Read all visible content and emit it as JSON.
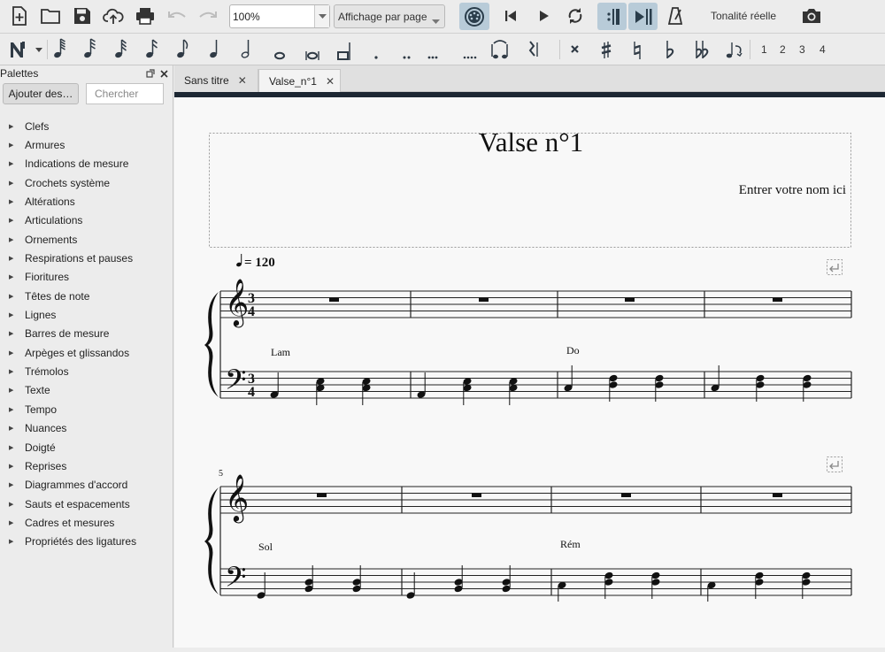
{
  "toolbar": {
    "zoom_value": "100%",
    "view_mode": "Affichage par page",
    "concert_pitch_label": "Tonalité réelle"
  },
  "note_input": {
    "voices": [
      "1",
      "2",
      "3",
      "4"
    ]
  },
  "palettes": {
    "title": "Palettes",
    "add_button": "Ajouter des…",
    "search_placeholder": "Chercher",
    "items": [
      {
        "label": "Clefs"
      },
      {
        "label": "Armures"
      },
      {
        "label": "Indications de mesure"
      },
      {
        "label": "Crochets système"
      },
      {
        "label": "Altérations"
      },
      {
        "label": "Articulations"
      },
      {
        "label": "Ornements"
      },
      {
        "label": "Respirations et pauses"
      },
      {
        "label": "Fioritures"
      },
      {
        "label": "Têtes de note"
      },
      {
        "label": "Lignes"
      },
      {
        "label": "Barres de mesure"
      },
      {
        "label": "Arpèges et glissandos"
      },
      {
        "label": "Trémolos"
      },
      {
        "label": "Texte"
      },
      {
        "label": "Tempo"
      },
      {
        "label": "Nuances"
      },
      {
        "label": "Doigté"
      },
      {
        "label": "Reprises"
      },
      {
        "label": "Diagrammes d'accord"
      },
      {
        "label": "Sauts et espacements"
      },
      {
        "label": "Cadres et mesures"
      },
      {
        "label": "Propriétés des ligatures"
      }
    ]
  },
  "tabs": [
    {
      "label": "Sans titre",
      "active": false
    },
    {
      "label": "Valse_n°1",
      "active": true
    }
  ],
  "score": {
    "title": "Valse n°1",
    "composer": "Entrer votre nom ici",
    "tempo_text": "= 120",
    "time_signature": {
      "numerator": "3",
      "denominator": "4"
    },
    "system2_measure_number": "5",
    "chords_system1": [
      "Lam",
      "Do"
    ],
    "chords_system2": [
      "Sol",
      "Rém"
    ]
  }
}
